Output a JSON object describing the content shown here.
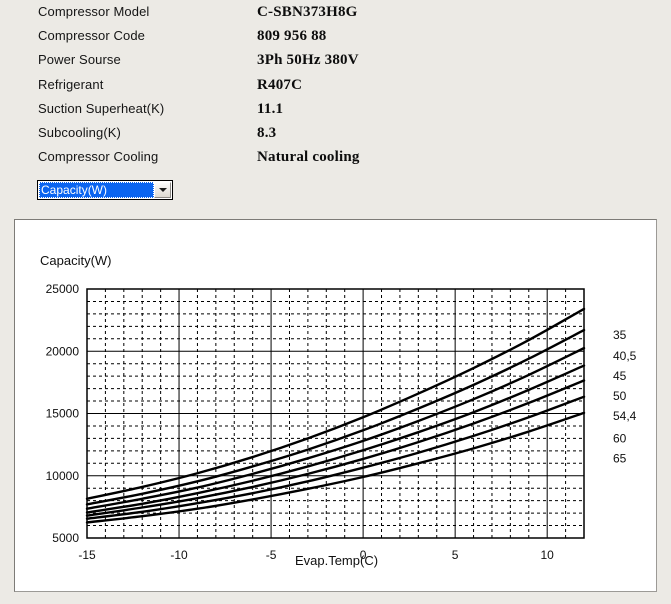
{
  "spec": {
    "rows": [
      {
        "label": "Compressor  Model",
        "value": "C-SBN373H8G"
      },
      {
        "label": "Compressor Code",
        "value": "809 956 88"
      },
      {
        "label": "Power Sourse",
        "value": "3Ph  50Hz  380V"
      },
      {
        "label": "Refrigerant",
        "value": "R407C"
      },
      {
        "label": "Suction Superheat(K)",
        "value": "11.1"
      },
      {
        "label": "Subcooling(K)",
        "value": "8.3"
      },
      {
        "label": "Compressor Cooling",
        "value": "Natural cooling"
      }
    ]
  },
  "select": {
    "value": "Capacity(W)",
    "options": [
      "Capacity(W)"
    ],
    "highlight_color": "#0a64f0"
  },
  "chart_data": {
    "type": "line",
    "title": "",
    "ylabel": "Capacity(W)",
    "xlabel": "Evap.Temp(C)",
    "xlim": [
      -15,
      12
    ],
    "ylim": [
      5000,
      25000
    ],
    "xticks": [
      -15,
      -10,
      -5,
      0,
      5,
      10
    ],
    "xtick_labels": [
      "-15",
      "-10",
      "-5",
      "0",
      "5",
      "10"
    ],
    "yticks": [
      5000,
      10000,
      15000,
      20000,
      25000
    ],
    "ytick_labels": [
      "5000",
      "10000",
      "15000",
      "20000",
      "25000"
    ],
    "x_minor_step": 1,
    "y_minor_step": 1000,
    "grid": true,
    "legend_position": "right-outside",
    "legend_title": "",
    "line_color": "#000000",
    "x": [
      -15,
      -12,
      -9,
      -6,
      -3,
      0,
      3,
      6,
      9,
      12
    ],
    "series": [
      {
        "name": "35",
        "label_y_value": 21300,
        "values": [
          8150,
          9100,
          10200,
          11500,
          13000,
          14700,
          16600,
          18650,
          20900,
          23400
        ]
      },
      {
        "name": "40,5",
        "label_y_value": 19600,
        "values": [
          7700,
          8550,
          9550,
          10750,
          12100,
          13650,
          15400,
          17300,
          19400,
          21700
        ]
      },
      {
        "name": "45",
        "label_y_value": 18000,
        "values": [
          7350,
          8150,
          9050,
          10150,
          11400,
          12800,
          14400,
          16150,
          18100,
          20250
        ]
      },
      {
        "name": "50",
        "label_y_value": 16400,
        "values": [
          7050,
          7750,
          8600,
          9600,
          10750,
          12050,
          13500,
          15100,
          16900,
          18850
        ]
      },
      {
        "name": "54,4",
        "label_y_value": 14800,
        "values": [
          6800,
          7450,
          8200,
          9100,
          10150,
          11350,
          12700,
          14200,
          15850,
          17650
        ]
      },
      {
        "name": "60",
        "label_y_value": 13000,
        "values": [
          6550,
          7100,
          7800,
          8600,
          9550,
          10650,
          11850,
          13200,
          14700,
          16350
        ]
      },
      {
        "name": "65",
        "label_y_value": 11400,
        "values": [
          6250,
          6750,
          7350,
          8100,
          8950,
          9900,
          11000,
          12200,
          13550,
          15050
        ]
      }
    ]
  }
}
